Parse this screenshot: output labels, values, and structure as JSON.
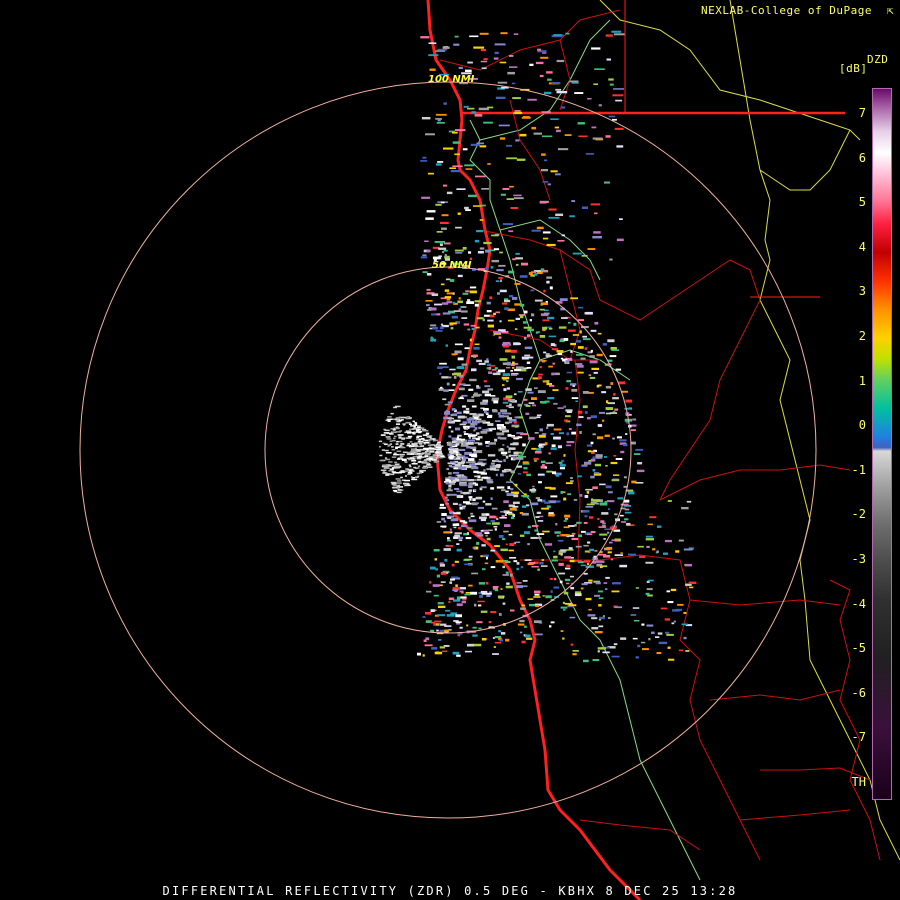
{
  "header": {
    "credit": "NEXLAB-College of DuPage",
    "credit_icon": "cursor-icon"
  },
  "legend": {
    "product": "DZD",
    "units": "[dB]",
    "labels": [
      "7",
      "6",
      "5",
      "4",
      "3",
      "2",
      "1",
      "0",
      "-1",
      "-2",
      "-3",
      "-4",
      "-5",
      "-6",
      "-7",
      "TH"
    ]
  },
  "rings": [
    {
      "label": "50 NMI"
    },
    {
      "label": "100 NMI"
    }
  ],
  "footer": {
    "caption": "DIFFERENTIAL REFLECTIVITY (ZDR) 0.5 DEG - KBHX 8 DEC 25 13:28"
  },
  "colors": {
    "background": "#000000",
    "range_ring": "#f0b0a0",
    "coastline": "#ff2020",
    "state_border": "#ff2020",
    "county_border": "#cc1111",
    "river": "#88dd88",
    "highway": "#dddd44",
    "label": "#ffff66"
  }
}
